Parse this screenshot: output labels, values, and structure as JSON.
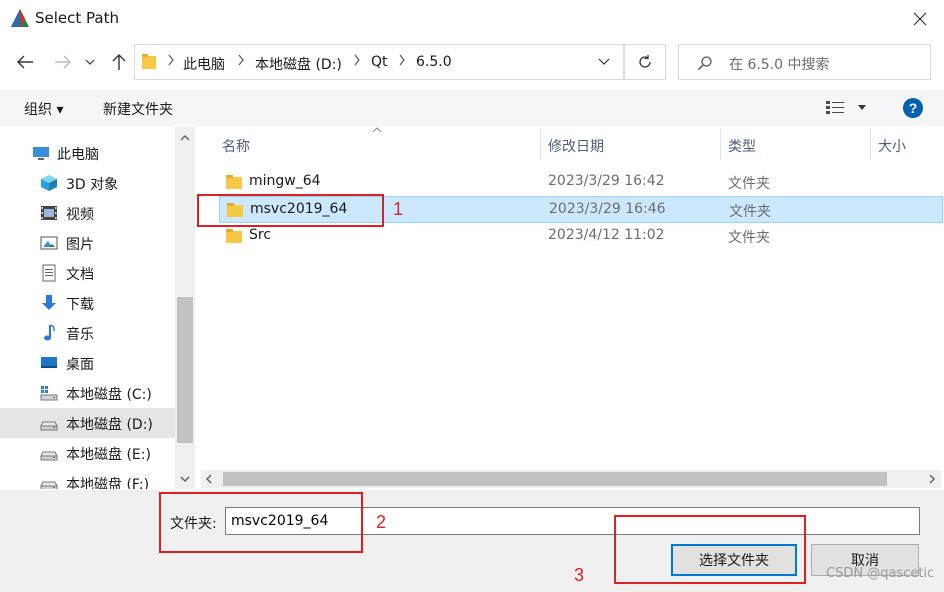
{
  "window": {
    "title": "Select Path"
  },
  "address": {
    "crumbs": [
      "此电脑",
      "本地磁盘 (D:)",
      "Qt",
      "6.5.0"
    ]
  },
  "search": {
    "placeholder": "在 6.5.0 中搜索"
  },
  "toolbar": {
    "organize": "组织 ▾",
    "new_folder": "新建文件夹",
    "help": "?"
  },
  "nav": {
    "items": [
      {
        "label": "此电脑",
        "icon": "pc-icon"
      },
      {
        "label": "3D 对象",
        "icon": "cube-3d-icon"
      },
      {
        "label": "视频",
        "icon": "video-icon"
      },
      {
        "label": "图片",
        "icon": "pictures-icon"
      },
      {
        "label": "文档",
        "icon": "documents-icon"
      },
      {
        "label": "下载",
        "icon": "download-icon"
      },
      {
        "label": "音乐",
        "icon": "music-icon"
      },
      {
        "label": "桌面",
        "icon": "desktop-icon"
      },
      {
        "label": "本地磁盘 (C:)",
        "icon": "drive-windows-icon"
      },
      {
        "label": "本地磁盘 (D:)",
        "icon": "drive-icon"
      },
      {
        "label": "本地磁盘 (E:)",
        "icon": "drive-icon"
      },
      {
        "label": "本地磁盘 (F:)",
        "icon": "drive-icon"
      }
    ]
  },
  "list": {
    "columns": [
      "名称",
      "修改日期",
      "类型",
      "大小"
    ],
    "rows": [
      {
        "name": "mingw_64",
        "date": "2023/3/29 16:42",
        "type": "文件夹"
      },
      {
        "name": "msvc2019_64",
        "date": "2023/3/29 16:46",
        "type": "文件夹"
      },
      {
        "name": "Src",
        "date": "2023/4/12 11:02",
        "type": "文件夹"
      }
    ]
  },
  "bottom": {
    "folder_label": "文件夹:",
    "folder_value": "msvc2019_64",
    "select_button": "选择文件夹",
    "cancel_button": "取消"
  },
  "annotations": {
    "n1": "1",
    "n2": "2",
    "n3": "3",
    "watermark": "CSDN @qascetic"
  },
  "colors": {
    "accent": "#0078d7",
    "selection": "#cce8ff",
    "annotation": "#e02020",
    "folder": "#f8c744"
  }
}
